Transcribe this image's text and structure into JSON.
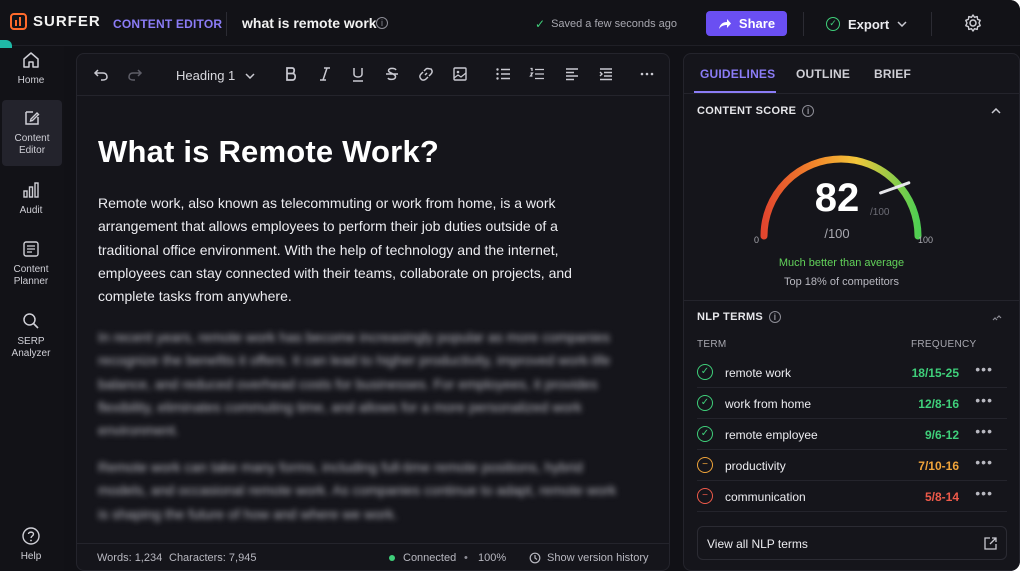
{
  "colors": {
    "accent": "#8b7cf6",
    "brand": "#ff6a2b",
    "good": "#3fcf7a",
    "warn": "#f0a43a",
    "bad": "#ef5a4a"
  },
  "app": {
    "logo": "SURFER"
  },
  "header": {
    "section": "CONTENT EDITOR",
    "doc_title": "what is remote work",
    "info": "i",
    "saved": "Saved a few seconds ago",
    "share": "Share",
    "export": "Export"
  },
  "nav": [
    {
      "label": "Home",
      "icon": "home-icon"
    },
    {
      "label": "Content Editor",
      "icon": "edit-icon"
    },
    {
      "label": "Audit",
      "icon": "bar-chart-icon"
    },
    {
      "label": "Content Planner",
      "icon": "planner-icon"
    },
    {
      "label": "SERP Analyzer",
      "icon": "search-icon"
    },
    {
      "label": "Help",
      "icon": "help-icon"
    }
  ],
  "toolbar": {
    "heading": "Heading 1"
  },
  "doc": {
    "h1": "What is Remote Work?",
    "p1": "Remote work, also known as telecommuting or work from home, is a work arrangement that allows employees to perform their job duties outside of a traditional office environment. With the help of technology and the internet, employees can stay connected with their teams, collaborate on projects, and complete tasks from anywhere.",
    "p2": "In recent years, remote work has become increasingly popular as more companies recognize the benefits it offers. It can lead to higher productivity, improved work-life balance, and reduced overhead costs for businesses. For employees, it provides flexibility, eliminates commuting time, and allows for a more personalized work environment.",
    "p3": "Remote work can take many forms, including full-time remote positions, hybrid models, and occasional remote work. As companies continue to adapt, remote work is shaping the future of how and where we work."
  },
  "status": {
    "words": "Words: 1,234",
    "characters": "Characters: 7,945",
    "connected": "Connected",
    "zoom": "100%",
    "history": "Show version history"
  },
  "panel": {
    "tabs": [
      "GUIDELINES",
      "OUTLINE",
      "BRIEF"
    ],
    "score_title": "CONTENT SCORE",
    "score": 82,
    "score_text": "82",
    "score_den": "/100",
    "score_min": "0",
    "score_max": "100",
    "verdict": "Much better than average",
    "rank": "Top 18% of competitors",
    "nlp_title": "NLP TERMS",
    "col_term": "TERM",
    "col_freq": "FREQUENCY",
    "terms": [
      {
        "term": "remote work",
        "freq": "18/15-25",
        "status": "good"
      },
      {
        "term": "work from home",
        "freq": "12/8-16",
        "status": "good"
      },
      {
        "term": "remote employee",
        "freq": "9/6-12",
        "status": "good"
      },
      {
        "term": "productivity",
        "freq": "7/10-16",
        "status": "warn"
      },
      {
        "term": "communication",
        "freq": "5/8-14",
        "status": "bad"
      }
    ],
    "view_all": "View all NLP terms"
  }
}
